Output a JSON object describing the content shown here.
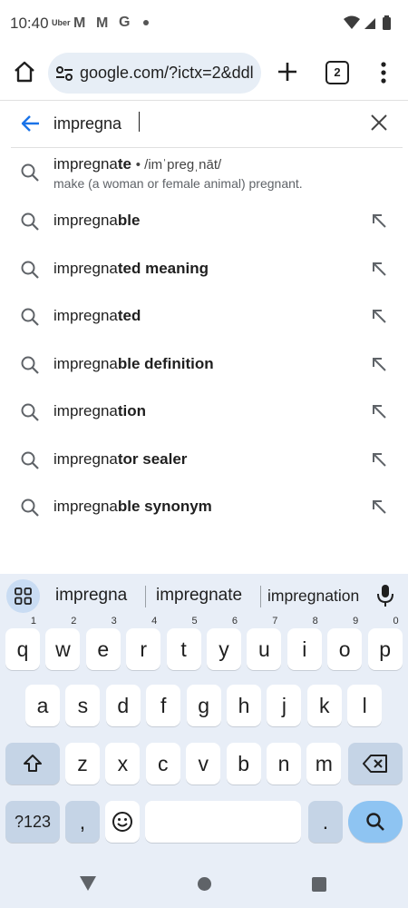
{
  "status_bar": {
    "time": "10:40",
    "notif_uber": "Uber",
    "notif_m1": "M",
    "notif_m2": "M",
    "notif_g": "G"
  },
  "browser": {
    "url": "google.com/?ictx=2&ddl",
    "tab_count": "2"
  },
  "search": {
    "query": "impregna"
  },
  "suggestions": [
    {
      "prefix": "impregna",
      "rest": "te",
      "phonetic": "• /imˈpreɡˌnāt/",
      "definition": "make (a woman or female animal) pregnant."
    },
    {
      "prefix": "impregna",
      "rest": "ble"
    },
    {
      "prefix": "impregna",
      "rest": "ted meaning"
    },
    {
      "prefix": "impregna",
      "rest": "ted"
    },
    {
      "prefix": "impregna",
      "rest": "ble definition"
    },
    {
      "prefix": "impregna",
      "rest": "tion"
    },
    {
      "prefix": "impregna",
      "rest": "tor sealer"
    },
    {
      "prefix": "impregna",
      "rest": "ble synonym"
    }
  ],
  "keyboard": {
    "suggestions": [
      "impregna",
      "impregnate",
      "impregnation"
    ],
    "row1": [
      {
        "k": "q",
        "s": "1"
      },
      {
        "k": "w",
        "s": "2"
      },
      {
        "k": "e",
        "s": "3"
      },
      {
        "k": "r",
        "s": "4"
      },
      {
        "k": "t",
        "s": "5"
      },
      {
        "k": "y",
        "s": "6"
      },
      {
        "k": "u",
        "s": "7"
      },
      {
        "k": "i",
        "s": "8"
      },
      {
        "k": "o",
        "s": "9"
      },
      {
        "k": "p",
        "s": "0"
      }
    ],
    "row2": [
      "a",
      "s",
      "d",
      "f",
      "g",
      "h",
      "j",
      "k",
      "l"
    ],
    "row3": [
      "z",
      "x",
      "c",
      "v",
      "b",
      "n",
      "m"
    ],
    "symbols_key": "?123",
    "comma_key": ",",
    "period_key": "."
  },
  "colors": {
    "accent_blue": "#1a73e8",
    "url_pill": "#e7eef6",
    "keyboard_bg": "#e8eef7",
    "search_key": "#8ec4f2"
  }
}
